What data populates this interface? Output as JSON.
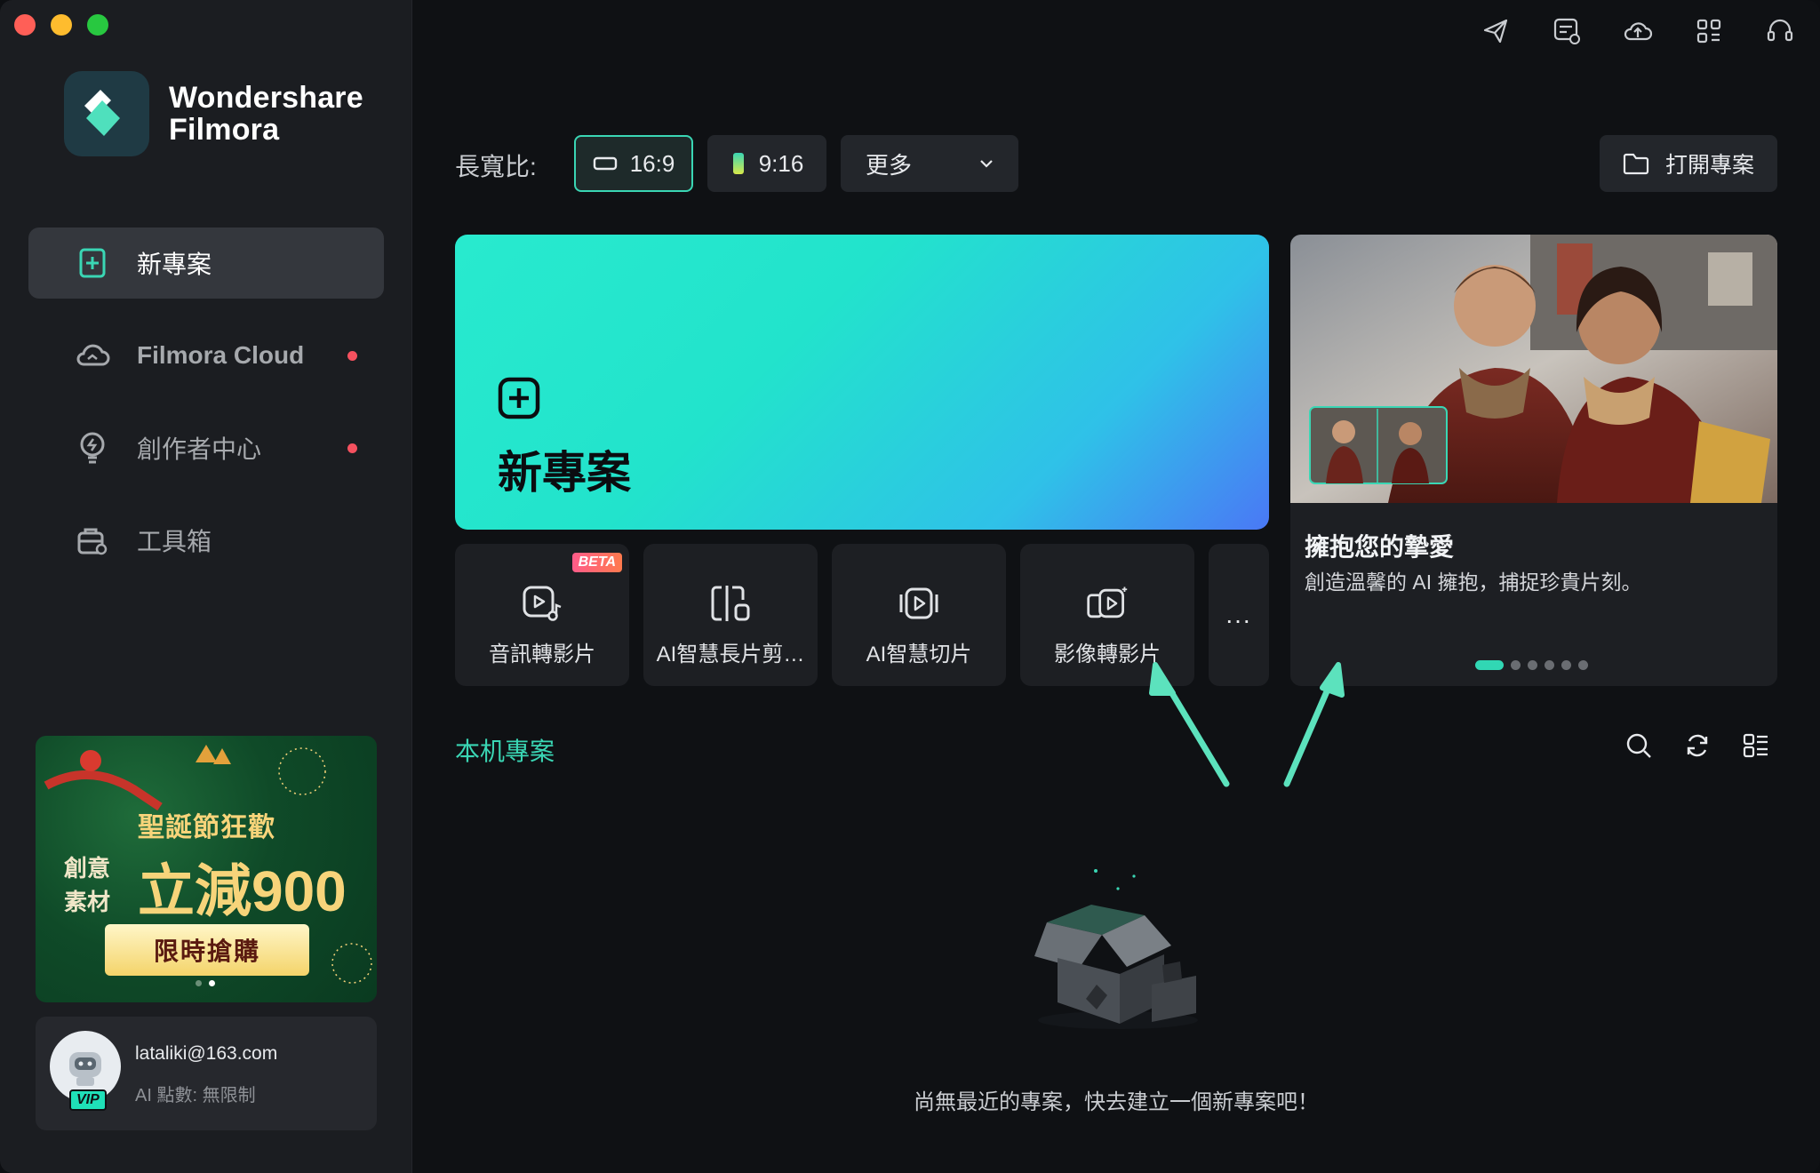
{
  "brand": {
    "line1": "Wondershare",
    "line2": "Filmora"
  },
  "sidebar": {
    "items": [
      {
        "label": "新專案",
        "icon": "new-project-icon",
        "active": true
      },
      {
        "label": "Filmora Cloud",
        "icon": "cloud-icon",
        "dot": true
      },
      {
        "label": "創作者中心",
        "icon": "lightbulb-icon",
        "dot": true
      },
      {
        "label": "工具箱",
        "icon": "toolbox-icon"
      }
    ]
  },
  "promo": {
    "title": "聖誕節狂歡",
    "side": "創意素材",
    "big": "立減900",
    "button": "限時搶購"
  },
  "user": {
    "email": "lataliki@163.com",
    "points": "AI 點數: 無限制",
    "badge": "VIP"
  },
  "aspect": {
    "label": "長寬比:",
    "opt1": "16:9",
    "opt2": "9:16",
    "more": "更多"
  },
  "open_project": "打開專案",
  "hero": {
    "label": "新專案"
  },
  "tools": [
    {
      "label": "音訊轉影片",
      "icon": "audio-to-video-icon",
      "badge": "BETA"
    },
    {
      "label": "AI智慧長片剪…",
      "icon": "ai-long-video-cut-icon"
    },
    {
      "label": "AI智慧切片",
      "icon": "ai-smart-slice-icon"
    },
    {
      "label": "影像轉影片",
      "icon": "image-to-video-icon"
    }
  ],
  "tools_more": "...",
  "carousel": {
    "title": "擁抱您的摯愛",
    "subtitle": "創造溫馨的 AI 擁抱，捕捉珍貴片刻。",
    "slides": 6,
    "active": 1
  },
  "local": {
    "title": "本机專案",
    "empty": "尚無最近的專案，快去建立一個新專案吧！"
  },
  "colors": {
    "accent": "#3ad6b4",
    "dot": "#f5515f",
    "beta": "#ff5c8a"
  }
}
